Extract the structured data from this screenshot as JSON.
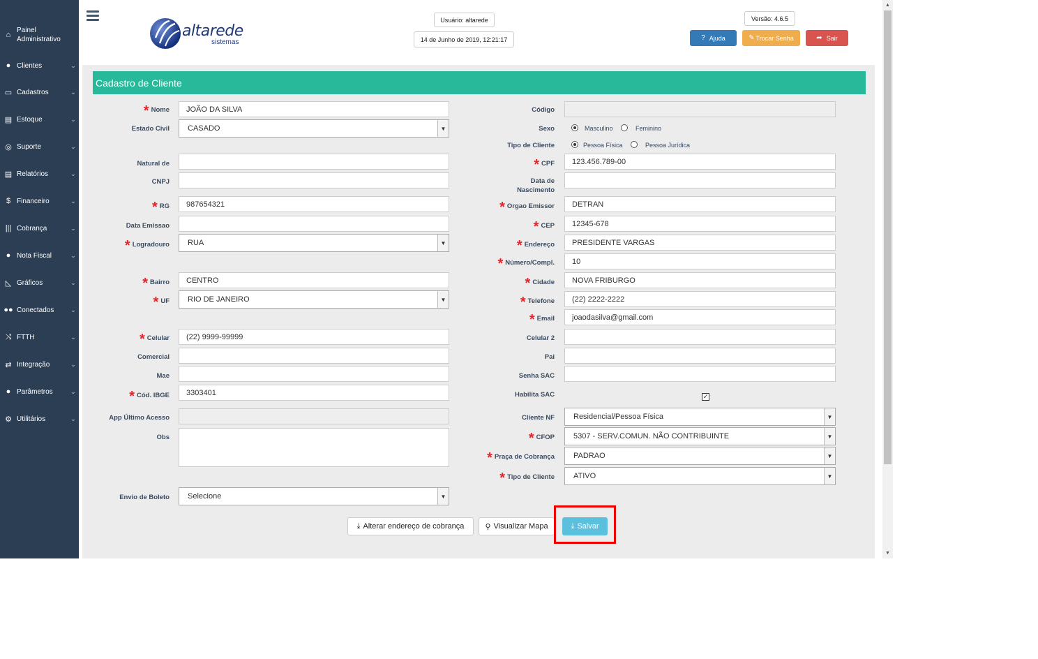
{
  "sidebar": {
    "items": [
      {
        "label": "Painel Administrativo",
        "icon": "home-icon",
        "glyph": "⌂"
      },
      {
        "label": "Clientes",
        "icon": "user-icon",
        "glyph": "●"
      },
      {
        "label": "Cadastros",
        "icon": "folder-icon",
        "glyph": "▭"
      },
      {
        "label": "Estoque",
        "icon": "printer-icon",
        "glyph": "▤"
      },
      {
        "label": "Suporte",
        "icon": "lifebuoy-icon",
        "glyph": "◎"
      },
      {
        "label": "Relatórios",
        "icon": "printer-icon",
        "glyph": "▤"
      },
      {
        "label": "Financeiro",
        "icon": "dollar-icon",
        "glyph": "$"
      },
      {
        "label": "Cobrança",
        "icon": "barcode-icon",
        "glyph": "|||"
      },
      {
        "label": "Nota Fiscal",
        "icon": "user-icon",
        "glyph": "●"
      },
      {
        "label": "Gráficos",
        "icon": "area-chart-icon",
        "glyph": "◺"
      },
      {
        "label": "Conectados",
        "icon": "users-icon",
        "glyph": "●●"
      },
      {
        "label": "FTTH",
        "icon": "random-icon",
        "glyph": "⤨"
      },
      {
        "label": "Integração",
        "icon": "exchange-icon",
        "glyph": "⇄"
      },
      {
        "label": "Parâmetros",
        "icon": "user-icon",
        "glyph": "●"
      },
      {
        "label": "Utilitários",
        "icon": "cogs-icon",
        "glyph": "⚙"
      }
    ]
  },
  "header": {
    "logo_text": "altarede",
    "logo_sub": "sistemas",
    "user": "Usuário: altarede",
    "datetime": "14 de Junho de 2019, 12:21:17",
    "version": "Versão: 4.6.5",
    "help_label": "Ajuda",
    "change_password_label": "Trocar Senha",
    "logout_label": "Sair",
    "colors": {
      "help": "#337ab7",
      "change_password": "#f0ad4e",
      "logout": "#d9534f"
    }
  },
  "form": {
    "title": "Cadastro de Cliente",
    "left": {
      "nome": {
        "label": "Nome",
        "value": "JOÃO DA SILVA"
      },
      "estado_civil": {
        "label": "Estado Civil",
        "value": "CASADO"
      },
      "natural_de": {
        "label": "Natural de",
        "value": ""
      },
      "cnpj": {
        "label": "CNPJ",
        "value": ""
      },
      "rg": {
        "label": "RG",
        "value": "987654321"
      },
      "data_emissao": {
        "label": "Data Emissao",
        "value": ""
      },
      "logradouro": {
        "label": "Logradouro",
        "value": "RUA"
      },
      "bairro": {
        "label": "Bairro",
        "value": "CENTRO"
      },
      "uf": {
        "label": "UF",
        "value": "RIO DE JANEIRO"
      },
      "celular": {
        "label": "Celular",
        "value": "(22) 9999-99999"
      },
      "comercial": {
        "label": "Comercial",
        "value": ""
      },
      "mae": {
        "label": "Mae",
        "value": ""
      },
      "cod_ibge": {
        "label": "Cód. IBGE",
        "value": "3303401"
      },
      "app_ultimo_acesso": {
        "label": "App Último Acesso",
        "value": ""
      },
      "obs": {
        "label": "Obs",
        "value": ""
      },
      "envio_boleto": {
        "label": "Envio de Boleto",
        "value": "Selecione"
      }
    },
    "right": {
      "codigo": {
        "label": "Código",
        "value": ""
      },
      "sexo": {
        "label": "Sexo",
        "options": [
          "Masculino",
          "Feminino"
        ],
        "selected": "Masculino"
      },
      "tipo_cliente_radio": {
        "label": "Tipo de Cliente",
        "options": [
          "Pessoa Física",
          "Pessoa Jurídica"
        ],
        "selected": "Pessoa Física"
      },
      "cpf": {
        "label": "CPF",
        "value": "123.456.789-00"
      },
      "data_nascimento": {
        "label_line1": "Data de",
        "label_line2": "Nascimento",
        "value": ""
      },
      "orgao_emissor": {
        "label": "Orgao Emissor",
        "value": "DETRAN"
      },
      "cep": {
        "label": "CEP",
        "value": "12345-678"
      },
      "endereco": {
        "label": "Endereço",
        "value": "PRESIDENTE VARGAS"
      },
      "numero": {
        "label": "Número/Compl.",
        "value": "10"
      },
      "cidade": {
        "label": "Cidade",
        "value": "NOVA FRIBURGO"
      },
      "telefone": {
        "label": "Telefone",
        "value": "(22) 2222-2222"
      },
      "email": {
        "label": "Email",
        "value": "joaodasilva@gmail.com"
      },
      "celular2": {
        "label": "Celular 2",
        "value": ""
      },
      "pai": {
        "label": "Pai",
        "value": ""
      },
      "senha_sac": {
        "label": "Senha SAC",
        "value": ""
      },
      "habilita_sac": {
        "label": "Habilita SAC",
        "checked": true
      },
      "cliente_nf": {
        "label": "Cliente NF",
        "value": "Residencial/Pessoa Física"
      },
      "cfop": {
        "label": "CFOP",
        "value": "5307 - SERV.COMUN. NÃO CONTRIBUINTE"
      },
      "praca_cobranca": {
        "label": "Praça de Cobrança",
        "value": "PADRAO"
      },
      "tipo_cliente_sel": {
        "label": "Tipo de Cliente",
        "value": "ATIVO"
      }
    },
    "actions": {
      "alterar_endereco": "Alterar endereço de cobrança",
      "visualizar_mapa": "Visualizar Mapa",
      "salvar": "Salvar"
    }
  }
}
